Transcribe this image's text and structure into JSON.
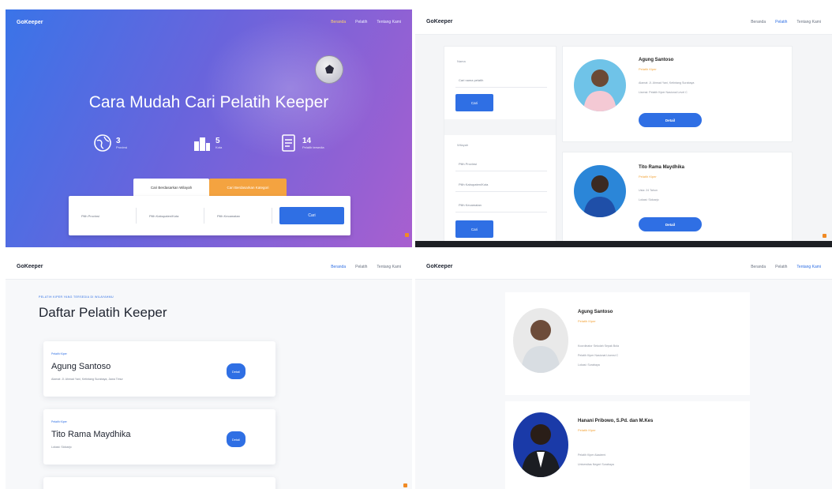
{
  "panel1": {
    "brand": "GoKeeper",
    "nav": [
      "Beranda",
      "Pelatih",
      "Tentang Kami"
    ],
    "hero_title": "Cara Mudah Cari Pelatih Keeper",
    "stats": [
      {
        "num": "3",
        "label": "Provinsi",
        "icon": "globe-icon"
      },
      {
        "num": "5",
        "label": "Kota",
        "icon": "city-icon"
      },
      {
        "num": "14",
        "label": "Pelatih tersedia",
        "icon": "document-icon"
      }
    ],
    "tabs": [
      "Cari Berdasarkan Wilayah",
      "Cari Berdasarkan Kategori"
    ],
    "search_fields": [
      "Pilih Provinsi",
      "Pilih Kabupaten/Kota",
      "Pilih Kecamatan"
    ],
    "search_button": "Cari"
  },
  "panel2": {
    "brand": "GoKeeper",
    "nav": [
      "Beranda",
      "Pelatih",
      "Tentang Kami"
    ],
    "filter_label_1": "Nama",
    "filter_input_1": "Cari nama pelatih",
    "filter_button_1": "Cari",
    "filter_label_2": "Wilayah",
    "filter_inputs": [
      "Pilih Provinsi",
      "Pilih Kabupaten/Kota",
      "Pilih Kecamatan"
    ],
    "filter_button_2": "Cari",
    "coaches": [
      {
        "name": "Agung Santoso",
        "badge": "Pelatih Kiper",
        "lines": [
          "Alamat: Jl. Ahmad Yani, Ketintang Surabaya",
          "Lisensi: Pelatih Kiper Nasional Level C"
        ],
        "button": "Detail"
      },
      {
        "name": "Tito Rama Maydhika",
        "badge": "Pelatih Kiper",
        "lines": [
          "Usia: 24 Tahun",
          "Lokasi: Sidoarjo"
        ],
        "button": "Detail"
      }
    ]
  },
  "panel3": {
    "brand": "GoKeeper",
    "nav": [
      "Beranda",
      "Pelatih",
      "Tentang Kami"
    ],
    "crumb": "PELATIH KIPER YANG TERSEDIA DI WILAYAHMU",
    "title": "Daftar Pelatih Keeper",
    "list": [
      {
        "small": "Pelatih Kiper",
        "name": "Agung Santoso",
        "sub": "Alamat: Jl. Ahmad Yani, Ketintang Surabaya, Jawa Timur",
        "button": "Detail"
      },
      {
        "small": "Pelatih Kiper",
        "name": "Tito Rama Maydhika",
        "sub": "Lokasi: Sidoarjo",
        "button": "Detail"
      }
    ]
  },
  "panel4": {
    "brand": "GoKeeper",
    "nav": [
      "Beranda",
      "Pelatih",
      "Tentang Kami"
    ],
    "profiles": [
      {
        "name": "Agung Santoso",
        "badge": "Pelatih Kiper",
        "lines": [
          "Koordinator Sekolah Sepak Bola",
          "Pelatih Kiper Nasional Lisensi C",
          "Lokasi: Surabaya"
        ]
      },
      {
        "name": "Hanani Pribowo, S.Pd. dan M.Kes",
        "badge": "Pelatih Kiper",
        "lines": [
          "Pelatih Kiper Akademi",
          "Universitas Negeri Surabaya"
        ]
      }
    ]
  },
  "colors": {
    "primary": "#2f6fe4",
    "accent": "#f4a340",
    "hero_start": "#3a74e8",
    "hero_end": "#a85fcf"
  }
}
